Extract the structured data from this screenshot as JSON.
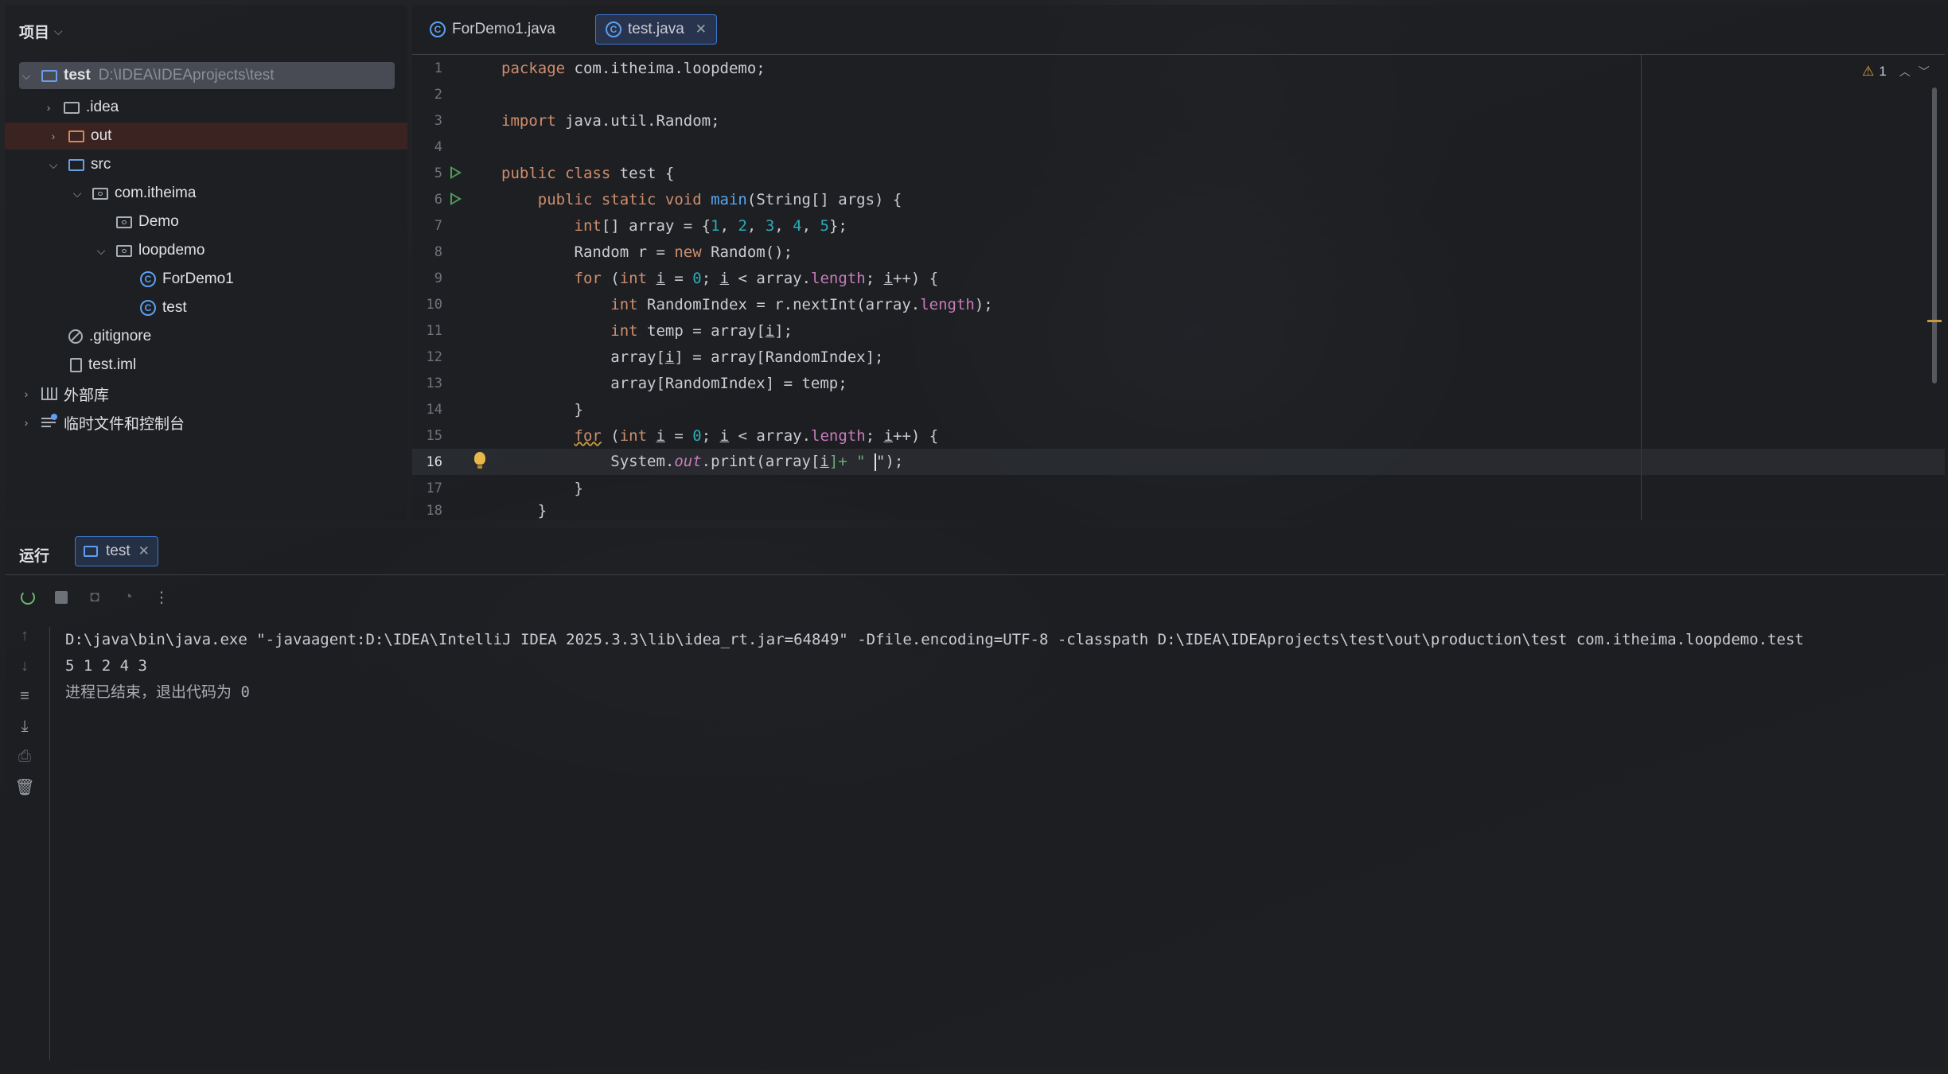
{
  "project": {
    "header": "项目",
    "tree": [
      {
        "label": "test",
        "path": "D:\\IDEA\\IDEAprojects\\test"
      },
      {
        "label": ".idea"
      },
      {
        "label": "out"
      },
      {
        "label": "src"
      },
      {
        "label": "com.itheima"
      },
      {
        "label": "Demo"
      },
      {
        "label": "loopdemo"
      },
      {
        "label": "ForDemo1"
      },
      {
        "label": "test"
      },
      {
        "label": ".gitignore"
      },
      {
        "label": "test.iml"
      },
      {
        "label": "外部库"
      },
      {
        "label": "临时文件和控制台"
      }
    ]
  },
  "editor": {
    "tabs": [
      {
        "label": "ForDemo1.java"
      },
      {
        "label": "test.java"
      }
    ],
    "inspection_count": "1",
    "line_numbers": [
      "1",
      "2",
      "3",
      "4",
      "5",
      "6",
      "7",
      "8",
      "9",
      "10",
      "11",
      "12",
      "13",
      "14",
      "15",
      "16",
      "17",
      "18"
    ],
    "code": {
      "l1a": "package",
      "l1b": " com.itheima.loopdemo;",
      "l3a": "import",
      "l3b": " java.util.Random;",
      "l5a": "public class",
      "l5b": " test {",
      "l6a": "    public static void ",
      "l6b": "main",
      "l6c": "(String[] args) {",
      "l7a": "        ",
      "l7b": "int",
      "l7c": "[] array = {",
      "l7d": "1",
      "l7e": ", ",
      "l7f": "2",
      "l7g": ", ",
      "l7h": "3",
      "l7i": ", ",
      "l7j": "4",
      "l7k": ", ",
      "l7l": "5",
      "l7m": "};",
      "l8a": "        Random r = ",
      "l8b": "new",
      "l8c": " Random();",
      "l9a": "        ",
      "l9b": "for",
      "l9c": " (",
      "l9d": "int",
      "l9e": " ",
      "l9f": "i",
      "l9g": " = ",
      "l9h": "0",
      "l9i": "; ",
      "l9j": "i",
      "l9k": " < array.",
      "l9l": "length",
      "l9m": "; ",
      "l9n": "i",
      "l9o": "++) {",
      "l10a": "            ",
      "l10b": "int",
      "l10c": " RandomIndex = r.nextInt(array.",
      "l10d": "length",
      "l10e": ");",
      "l11a": "            ",
      "l11b": "int",
      "l11c": " temp = array[",
      "l11d": "i",
      "l11e": "];",
      "l12a": "            array[",
      "l12b": "i",
      "l12c": "] = array[RandomIndex];",
      "l13": "            array[RandomIndex] = temp;",
      "l14": "        }",
      "l15a": "        ",
      "l15b": "for",
      "l15c": " (",
      "l15d": "int",
      "l15e": " ",
      "l15f": "i",
      "l15g": " = ",
      "l15h": "0",
      "l15i": "; ",
      "l15j": "i",
      "l15k": " < array.",
      "l15l": "length",
      "l15m": "; ",
      "l15n": "i",
      "l15o": "++) {",
      "l16a": "            System.",
      "l16b": "out",
      "l16c": ".print(array[",
      "l16d": "i",
      "l16e": "]+ \" ",
      "l16f": "\");",
      "l17": "        }",
      "l18": "    }"
    }
  },
  "run": {
    "title": "运行",
    "tab_label": "test",
    "output": [
      "D:\\java\\bin\\java.exe \"-javaagent:D:\\IDEA\\IntelliJ IDEA 2025.3.3\\lib\\idea_rt.jar=64849\" -Dfile.encoding=UTF-8 -classpath D:\\IDEA\\IDEAprojects\\test\\out\\production\\test com.itheima.loopdemo.test",
      "5 1 2 4 3",
      "进程已结束，退出代码为 0"
    ]
  },
  "colors": {
    "keyword": "#cf8e6d",
    "number": "#2aacb8",
    "method": "#56a8f5",
    "field": "#c77dbb",
    "accent": "#3f78d0",
    "run_green": "#4f9e5a"
  }
}
